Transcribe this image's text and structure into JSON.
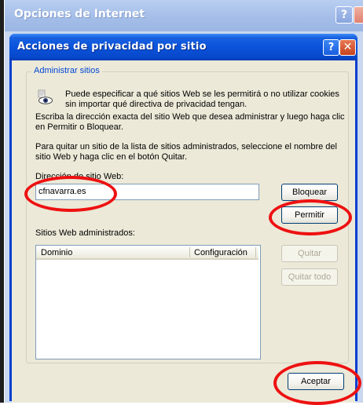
{
  "parent_window": {
    "title": "Opciones de Internet",
    "help_label": "?",
    "close_label": "X"
  },
  "dialog": {
    "title": "Acciones de privacidad por sitio",
    "help_label": "?",
    "close_label": "✕"
  },
  "group": {
    "legend": "Administrar sitios",
    "intro": "Puede especificar a qué sitios Web se les permitirá o no utilizar cookies sin importar qué directiva de privacidad tengan.",
    "instructions_add": "Escriba la dirección exacta del sitio Web que desea administrar y luego haga clic en Permitir o Bloquear.",
    "instructions_remove": "Para quitar un sitio de la lista de sitios administrados, seleccione el nombre del sitio Web y haga clic en el botón Quitar.",
    "address_label": "Dirección de sitio Web:",
    "address_value": "cfnavarra.es",
    "block_button": "Bloquear",
    "allow_button": "Permitir",
    "managed_label": "Sitios Web administrados:",
    "columns": [
      "Dominio",
      "Configuración"
    ],
    "remove_button": "Quitar",
    "remove_all_button": "Quitar todo"
  },
  "accept_button": "Aceptar",
  "annotation_color": "#ee1111"
}
